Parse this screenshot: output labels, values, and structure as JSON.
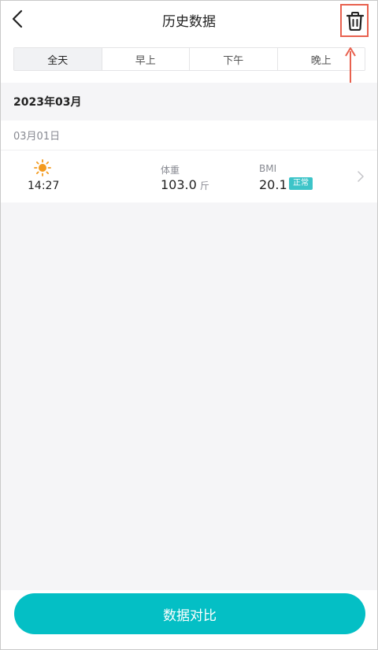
{
  "header": {
    "title": "历史数据",
    "back_icon": "chevron-left-icon",
    "delete_icon": "trash-icon"
  },
  "tabs": [
    {
      "label": "全天",
      "active": true
    },
    {
      "label": "早上",
      "active": false
    },
    {
      "label": "下午",
      "active": false
    },
    {
      "label": "晚上",
      "active": false
    }
  ],
  "month": "2023年03月",
  "day": "03月01日",
  "record": {
    "period_icon": "sun-icon",
    "time": "14:27",
    "weight_label": "体重",
    "weight_value": "103.0",
    "weight_unit": "斤",
    "bmi_label": "BMI",
    "bmi_value": "20.1",
    "bmi_status": "正常"
  },
  "compare_button": "数据对比",
  "colors": {
    "accent": "#04bfc5",
    "badge": "#3dc4c8",
    "sun": "#f39a1e",
    "annotation": "#e8614f"
  }
}
